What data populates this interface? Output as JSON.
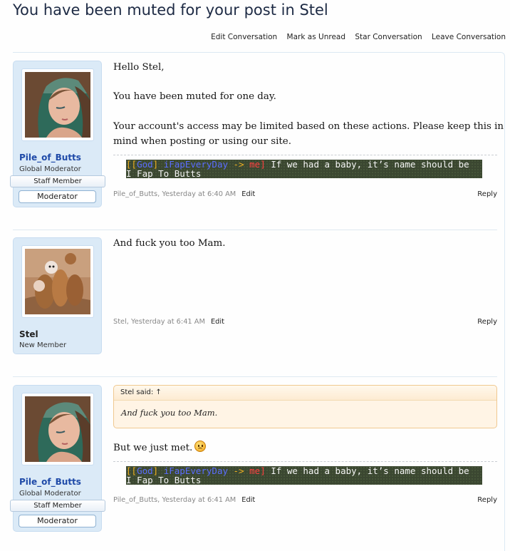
{
  "page_title": "You have been muted for your post in Stel",
  "controls": {
    "edit_conversation": "Edit Conversation",
    "mark_unread": "Mark as Unread",
    "star_conversation": "Star Conversation",
    "leave_conversation": "Leave Conversation"
  },
  "colors": {
    "username_link": "#1f4aa8",
    "signature_bg": "#3b4731",
    "quote_bg": "#fff4e5"
  },
  "signature": {
    "open_bracket": "[[",
    "rank": "God",
    "close_bracket": "]",
    "sender": "iFapEveryDay",
    "arrow": "->",
    "recipient": "me]",
    "line1_text": "If we had a baby, it’s name should be",
    "line2_text": "I_Fap_To_Butts"
  },
  "messages": [
    {
      "author": "Pile_of_Butts",
      "user_title": "Global Moderator",
      "ribbon": "Staff Member",
      "group_button": "Moderator",
      "avatar": "woman-portrait-avatar",
      "paragraphs": [
        "Hello Stel,",
        "You have been muted for one day.",
        "Your account's access may be limited based on these actions. Please keep this in",
        "mind when posting or using our site."
      ],
      "meta": "Pile_of_Butts, Yesterday at 6:40 AM",
      "edit": "Edit",
      "reply": "Reply"
    },
    {
      "author": "Stel",
      "user_title": "New Member",
      "avatar": "meerkats-avatar",
      "paragraphs": [
        "And fuck you too Mam."
      ],
      "meta": "Stel, Yesterday at 6:41 AM",
      "edit": "Edit",
      "reply": "Reply"
    },
    {
      "author": "Pile_of_Butts",
      "user_title": "Global Moderator",
      "ribbon": "Staff Member",
      "group_button": "Moderator",
      "avatar": "woman-portrait-avatar",
      "quote": {
        "attribution": "Stel said: ↑",
        "text": "And fuck you too Mam."
      },
      "paragraphs": [
        "But we just met."
      ],
      "smiley": "frown-smiley-icon",
      "meta": "Pile_of_Butts, Yesterday at 6:41 AM",
      "edit": "Edit",
      "reply": "Reply"
    }
  ]
}
